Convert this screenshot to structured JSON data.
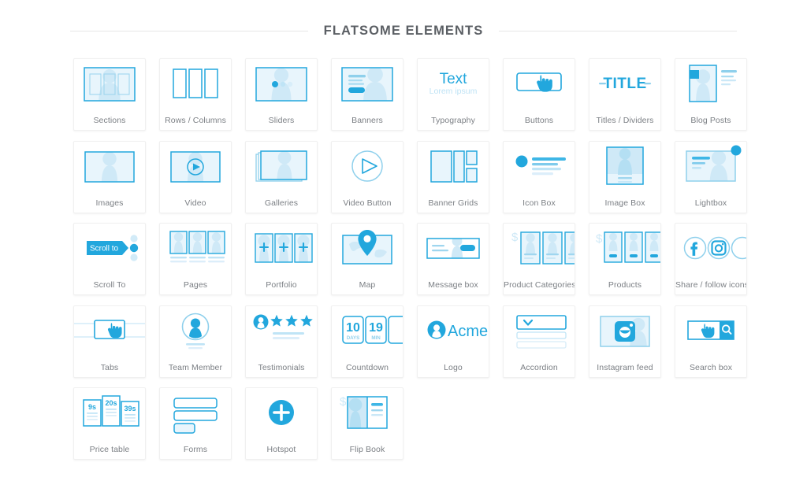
{
  "header": {
    "title": "FLATSOME ELEMENTS"
  },
  "colors": {
    "accent": "#22a7dd",
    "accent_dark": "#1b9ad2",
    "pale": "#cfe9f7",
    "paler": "#e8f5fc",
    "tile_border": "#f0f0f0",
    "label_text": "#7b7f84",
    "title_text": "#5b5f64",
    "rule": "#e6e6e6",
    "page_bg": "#ffffff"
  },
  "grid": {
    "columns": 8,
    "rows": 5,
    "tiles": [
      {
        "id": "sections",
        "label": "Sections",
        "icon": "sections-icon"
      },
      {
        "id": "rows-columns",
        "label": "Rows / Columns",
        "icon": "rows-columns-icon"
      },
      {
        "id": "sliders",
        "label": "Sliders",
        "icon": "sliders-icon"
      },
      {
        "id": "banners",
        "label": "Banners",
        "icon": "banners-icon"
      },
      {
        "id": "typography",
        "label": "Typography",
        "icon": "typography-icon"
      },
      {
        "id": "buttons",
        "label": "Buttons",
        "icon": "buttons-icon"
      },
      {
        "id": "titles-dividers",
        "label": "Titles / Dividers",
        "icon": "titles-dividers-icon"
      },
      {
        "id": "blog-posts",
        "label": "Blog Posts",
        "icon": "blog-posts-icon"
      },
      {
        "id": "images",
        "label": "Images",
        "icon": "images-icon"
      },
      {
        "id": "video",
        "label": "Video",
        "icon": "video-icon"
      },
      {
        "id": "galleries",
        "label": "Galleries",
        "icon": "galleries-icon"
      },
      {
        "id": "video-button",
        "label": "Video Button",
        "icon": "video-button-icon"
      },
      {
        "id": "banner-grids",
        "label": "Banner Grids",
        "icon": "banner-grids-icon"
      },
      {
        "id": "icon-box",
        "label": "Icon Box",
        "icon": "icon-box-icon"
      },
      {
        "id": "image-box",
        "label": "Image Box",
        "icon": "image-box-icon"
      },
      {
        "id": "lightbox",
        "label": "Lightbox",
        "icon": "lightbox-icon"
      },
      {
        "id": "scroll-to",
        "label": "Scroll To",
        "icon": "scroll-to-icon"
      },
      {
        "id": "pages",
        "label": "Pages",
        "icon": "pages-icon"
      },
      {
        "id": "portfolio",
        "label": "Portfolio",
        "icon": "portfolio-icon"
      },
      {
        "id": "map",
        "label": "Map",
        "icon": "map-pin-icon"
      },
      {
        "id": "message-box",
        "label": "Message box",
        "icon": "message-box-icon"
      },
      {
        "id": "product-categories",
        "label": "Product Categories",
        "icon": "product-categories-icon"
      },
      {
        "id": "products",
        "label": "Products",
        "icon": "products-icon"
      },
      {
        "id": "share-follow",
        "label": "Share / follow icons",
        "icon": "share-follow-icon"
      },
      {
        "id": "tabs",
        "label": "Tabs",
        "icon": "tabs-icon"
      },
      {
        "id": "team-member",
        "label": "Team Member",
        "icon": "team-member-icon"
      },
      {
        "id": "testimonials",
        "label": "Testimonials",
        "icon": "testimonials-icon"
      },
      {
        "id": "countdown",
        "label": "Countdown",
        "icon": "countdown-icon"
      },
      {
        "id": "logo",
        "label": "Logo",
        "icon": "logo-icon"
      },
      {
        "id": "accordion",
        "label": "Accordion",
        "icon": "accordion-icon"
      },
      {
        "id": "instagram-feed",
        "label": "Instagram feed",
        "icon": "instagram-icon"
      },
      {
        "id": "search-box",
        "label": "Search box",
        "icon": "search-box-icon"
      },
      {
        "id": "price-table",
        "label": "Price table",
        "icon": "price-table-icon"
      },
      {
        "id": "forms",
        "label": "Forms",
        "icon": "forms-icon"
      },
      {
        "id": "hotspot",
        "label": "Hotspot",
        "icon": "hotspot-icon"
      },
      {
        "id": "flip-book",
        "label": "Flip Book",
        "icon": "flip-book-icon"
      }
    ]
  },
  "artwork_text": {
    "typography_main": "Text",
    "typography_sub": "Lorem ipsum",
    "titles_divider": "TITLE",
    "scroll_to_button": "Scroll to",
    "countdown": [
      {
        "value": "10",
        "unit": "DAYS"
      },
      {
        "value": "19",
        "unit": "MIN"
      }
    ],
    "logo_text": "Acme",
    "price_table": [
      "9s",
      "20s",
      "39s"
    ],
    "currency_symbol": "$"
  }
}
